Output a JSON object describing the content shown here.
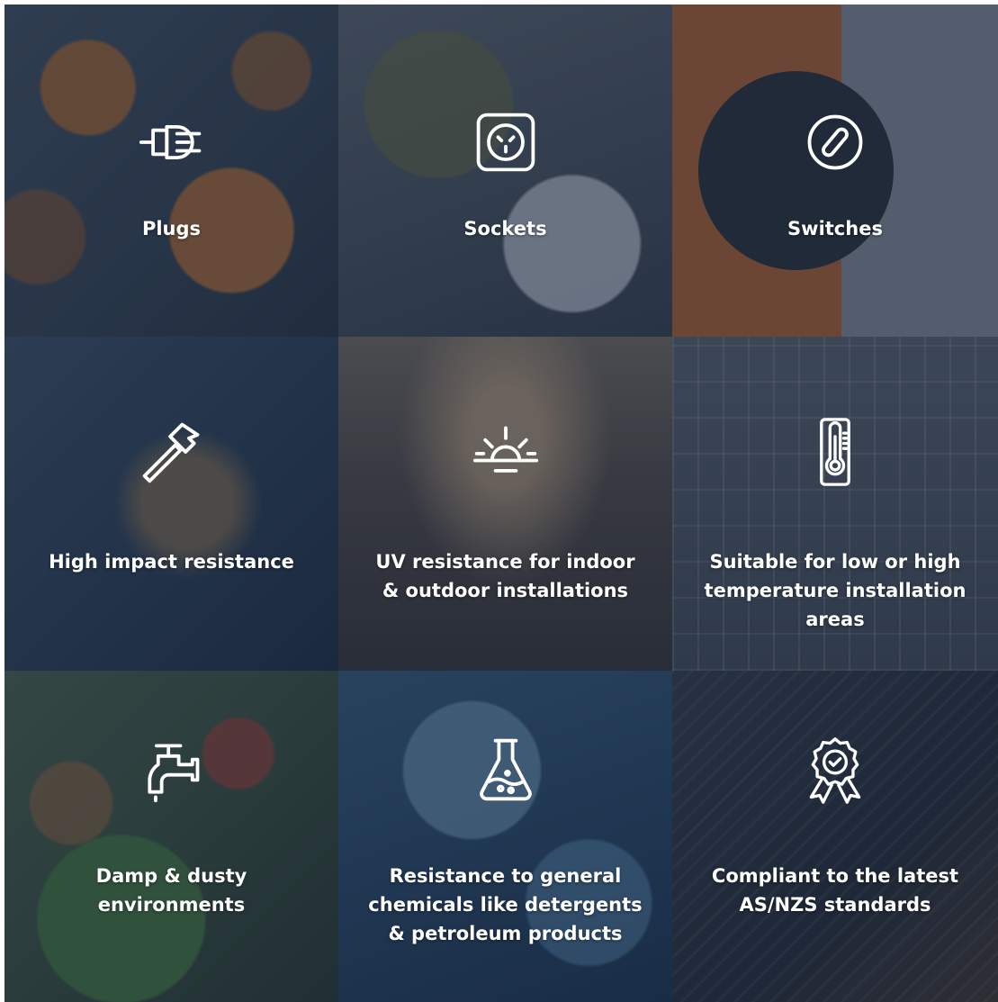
{
  "tiles": [
    {
      "label": "Plugs",
      "icon": "plug-icon"
    },
    {
      "label": "Sockets",
      "icon": "socket-icon"
    },
    {
      "label": "Switches",
      "icon": "switch-icon"
    },
    {
      "label": "High impact resistance",
      "icon": "hammer-icon"
    },
    {
      "label": "UV resistance for indoor\n& outdoor installations",
      "icon": "sun-icon"
    },
    {
      "label": "Suitable for low or high\ntemperature installation areas",
      "icon": "thermometer-icon"
    },
    {
      "label": "Damp & dusty\nenvironments",
      "icon": "tap-icon"
    },
    {
      "label": "Resistance to general\nchemicals like detergents\n& petroleum products",
      "icon": "flask-icon"
    },
    {
      "label": "Compliant to the latest\nAS/NZS standards",
      "icon": "award-ribbon-icon"
    }
  ],
  "colors": {
    "overlay": "#17263e",
    "text": "#ffffff"
  }
}
